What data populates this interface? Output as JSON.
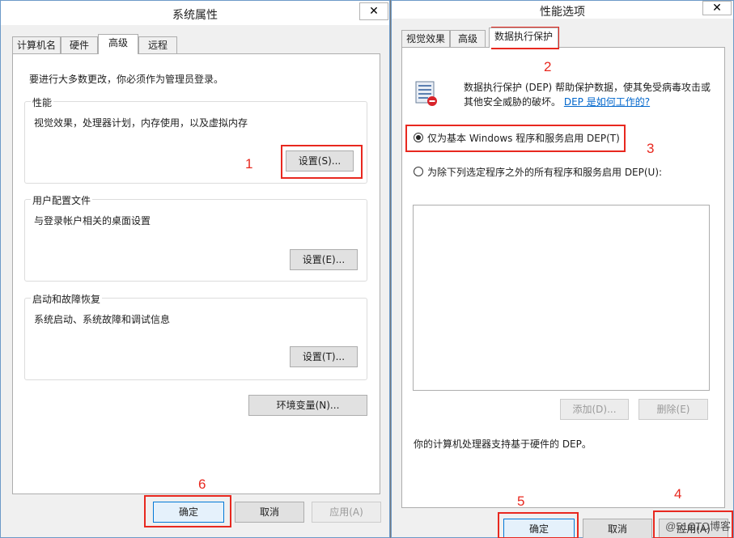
{
  "sys": {
    "title": "系统属性",
    "tabs": [
      "计算机名",
      "硬件",
      "高级",
      "远程"
    ],
    "admin_note": "要进行大多数更改，你必须作为管理员登录。",
    "perf": {
      "label": "性能",
      "desc": "视觉效果，处理器计划，内存使用，以及虚拟内存",
      "button": "设置(S)..."
    },
    "profile": {
      "label": "用户配置文件",
      "desc": "与登录帐户相关的桌面设置",
      "button": "设置(E)..."
    },
    "startup": {
      "label": "启动和故障恢复",
      "desc": "系统启动、系统故障和调试信息",
      "button": "设置(T)..."
    },
    "env_button": "环境变量(N)...",
    "ok": "确定",
    "cancel": "取消",
    "apply": "应用(A)"
  },
  "perf": {
    "title": "性能选项",
    "tabs": [
      "视觉效果",
      "高级",
      "数据执行保护"
    ],
    "dep_desc_line1": "数据执行保护 (DEP) 帮助保护数据，使其免受病毒攻击或",
    "dep_desc_line2": "其他安全威胁的破坏。",
    "dep_link": "DEP 是如何工作的?",
    "radio1": "仅为基本 Windows 程序和服务启用 DEP(T)",
    "radio2": "为除下列选定程序之外的所有程序和服务启用 DEP(U):",
    "add_button": "添加(D)...",
    "remove_button": "删除(E)",
    "support_note": "你的计算机处理器支持基于硬件的 DEP。",
    "ok": "确定",
    "cancel": "取消",
    "apply": "应用(A)"
  },
  "annotations": [
    "1",
    "2",
    "3",
    "4",
    "5",
    "6"
  ],
  "watermark": "@51CTO博客",
  "close_glyph": "✕",
  "colors": {
    "annotation_red": "#e8281f",
    "link_blue": "#0066cc",
    "accent": "#0078d7"
  }
}
